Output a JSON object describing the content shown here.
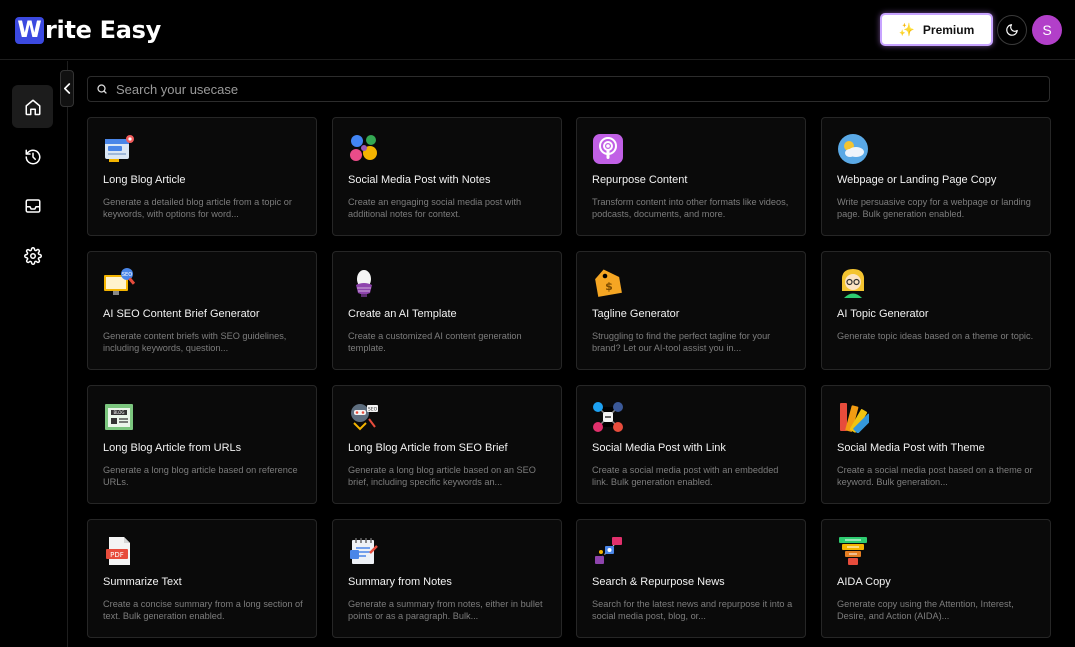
{
  "header": {
    "logo_mark": "W",
    "logo_text": "rite Easy",
    "premium_label": "Premium",
    "avatar_initial": "S"
  },
  "sidebar": {
    "items": [
      {
        "name": "home",
        "icon": "home-icon",
        "active": true
      },
      {
        "name": "history",
        "icon": "history-icon",
        "active": false
      },
      {
        "name": "inbox",
        "icon": "inbox-icon",
        "active": false
      },
      {
        "name": "settings",
        "icon": "gear-icon",
        "active": false
      }
    ]
  },
  "search": {
    "placeholder": "Search your usecase"
  },
  "colors": {
    "accent": "#3b49e0",
    "avatar": "#b23fc9",
    "premium_glow": "#c7a3ff"
  },
  "cards": [
    {
      "title": "Long Blog Article",
      "desc": "Generate a detailed blog article from a topic or keywords, with options for word...",
      "icon": "blog-icon"
    },
    {
      "title": "Social Media Post with Notes",
      "desc": "Create an engaging social media post with additional notes for context.",
      "icon": "social-bubbles-icon"
    },
    {
      "title": "Repurpose Content",
      "desc": "Transform content into other formats like videos, podcasts, documents, and more.",
      "icon": "podcast-icon"
    },
    {
      "title": "Webpage or Landing Page Copy",
      "desc": "Write persuasive copy for a webpage or landing page. Bulk generation enabled.",
      "icon": "weather-globe-icon"
    },
    {
      "title": "AI SEO Content Brief Generator",
      "desc": "Generate content briefs with SEO guidelines, including keywords, question...",
      "icon": "seo-monitor-icon"
    },
    {
      "title": "Create an AI Template",
      "desc": "Create a customized AI content generation template.",
      "icon": "egg-icon"
    },
    {
      "title": "Tagline Generator",
      "desc": "Struggling to find the perfect tagline for your brand? Let our AI-tool assist you in...",
      "icon": "price-tag-icon"
    },
    {
      "title": "AI Topic Generator",
      "desc": "Generate topic ideas based on a theme or topic.",
      "icon": "person-icon"
    },
    {
      "title": "Long Blog Article from URLs",
      "desc": "Generate a long blog article based on reference URLs.",
      "icon": "browser-blog-icon"
    },
    {
      "title": "Long Blog Article from SEO Brief",
      "desc": "Generate a long blog article based on an SEO brief, including specific keywords an...",
      "icon": "seo-robot-icon"
    },
    {
      "title": "Social Media Post with Link",
      "desc": "Create a social media post with an embedded link. Bulk generation enabled.",
      "icon": "social-network-icon"
    },
    {
      "title": "Social Media Post with Theme",
      "desc": "Create a social media post based on a theme or keyword. Bulk generation...",
      "icon": "color-palette-icon"
    },
    {
      "title": "Summarize Text",
      "desc": "Create a concise summary from a long section of text. Bulk generation enabled.",
      "icon": "pdf-icon"
    },
    {
      "title": "Summary from Notes",
      "desc": "Generate a summary from notes, either in bullet points or as a paragraph. Bulk...",
      "icon": "notes-icon"
    },
    {
      "title": "Search & Repurpose News",
      "desc": "Search for the latest news and repurpose it into a social media post, blog, or...",
      "icon": "news-search-icon"
    },
    {
      "title": "AIDA Copy",
      "desc": "Generate copy using the Attention, Interest, Desire, and Action (AIDA)...",
      "icon": "funnel-icon"
    }
  ]
}
